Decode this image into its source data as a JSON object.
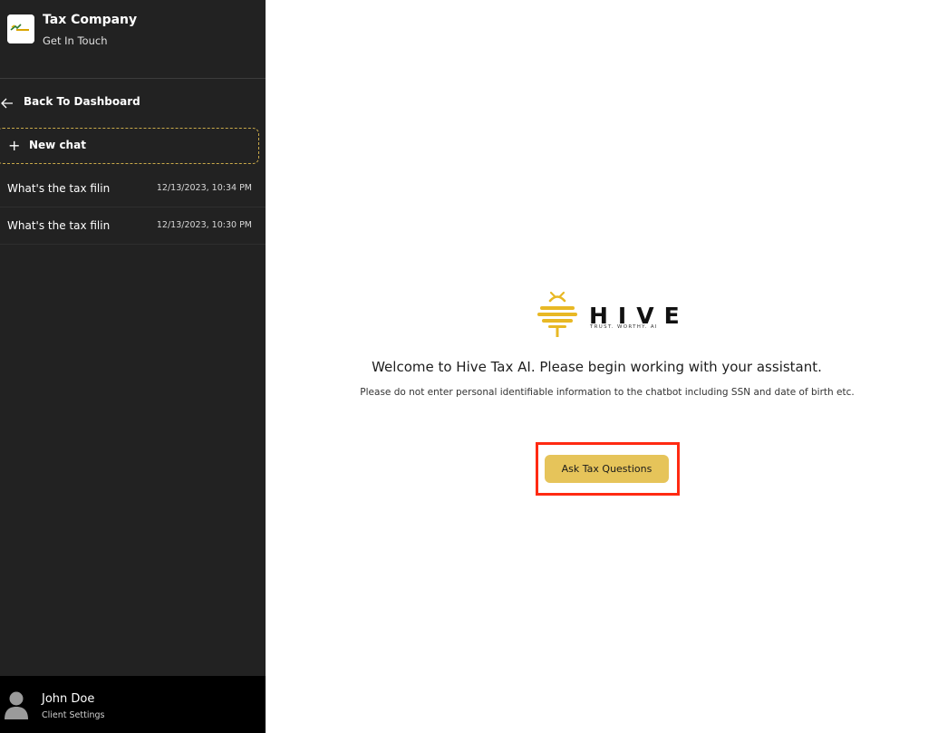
{
  "sidebar": {
    "company_name": "Tax Company",
    "company_sub": "Get In Touch",
    "back_label": "Back To Dashboard",
    "new_chat_label": "New chat",
    "history": [
      {
        "title": "What's the tax filin",
        "time": "12/13/2023, 10:34 PM"
      },
      {
        "title": "What's the tax filin",
        "time": "12/13/2023, 10:30 PM"
      }
    ],
    "user": {
      "name": "John Doe",
      "settings_label": "Client Settings"
    }
  },
  "main": {
    "brand_name": "HIVE",
    "brand_tagline": "TRUST. WORTHY. AI",
    "welcome": "Welcome to Hive Tax AI. Please begin working with your assistant.",
    "disclaimer": "Please do not enter personal identifiable information to the chatbot including SSN and date of birth etc.",
    "cta_label": "Ask Tax Questions"
  },
  "colors": {
    "sidebar_bg": "#222222",
    "user_bar_bg": "#000000",
    "accent_gold": "#e6c45a",
    "highlight_red": "#ff2a12"
  },
  "icons": {
    "back": "arrow-left-icon",
    "new_chat": "plus-icon",
    "avatar": "user-avatar-icon",
    "brand": "hive-bee-icon"
  }
}
